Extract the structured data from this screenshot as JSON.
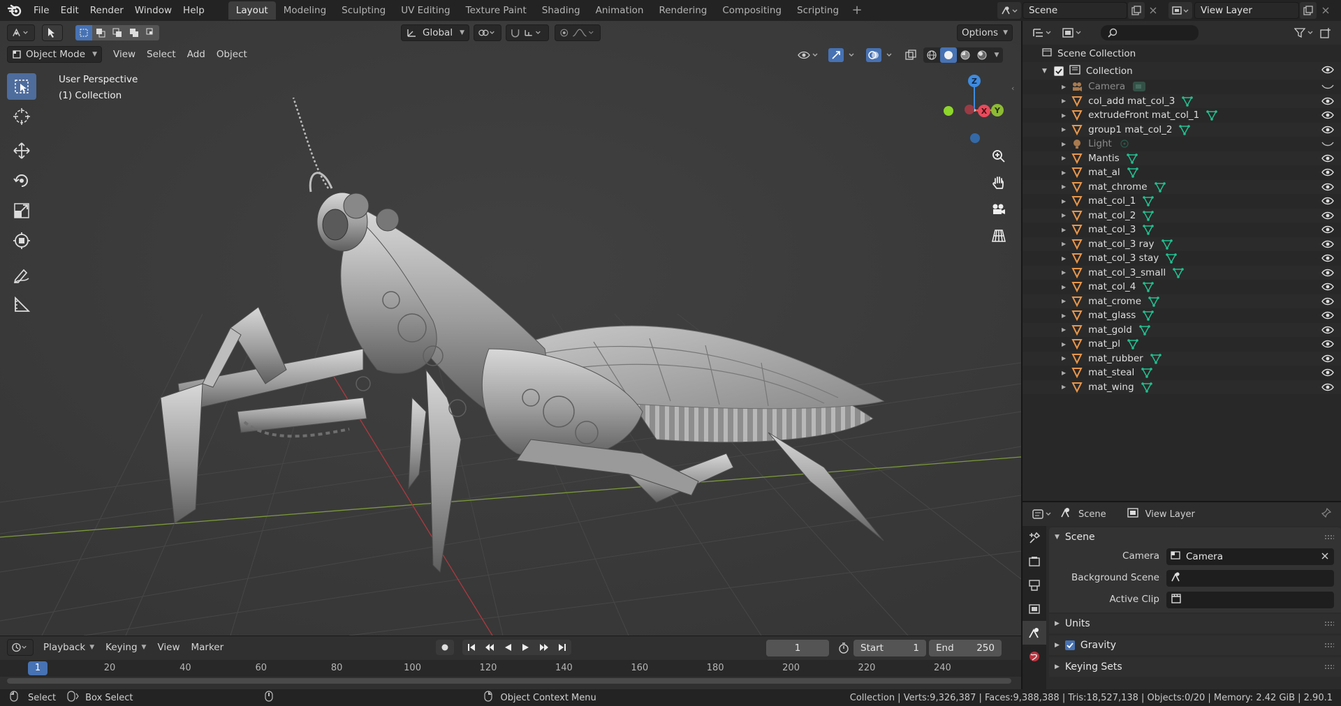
{
  "menu": [
    "File",
    "Edit",
    "Render",
    "Window",
    "Help"
  ],
  "workspaces": [
    {
      "label": "Layout",
      "active": true
    },
    {
      "label": "Modeling",
      "active": false
    },
    {
      "label": "Sculpting",
      "active": false
    },
    {
      "label": "UV Editing",
      "active": false
    },
    {
      "label": "Texture Paint",
      "active": false
    },
    {
      "label": "Shading",
      "active": false
    },
    {
      "label": "Animation",
      "active": false
    },
    {
      "label": "Rendering",
      "active": false
    },
    {
      "label": "Compositing",
      "active": false
    },
    {
      "label": "Scripting",
      "active": false
    }
  ],
  "scene_name": "Scene",
  "view_layer_name": "View Layer",
  "viewport": {
    "transform_orientation": "Global",
    "options_label": "Options",
    "mode": "Object Mode",
    "menus": [
      "View",
      "Select",
      "Add",
      "Object"
    ],
    "overlay_title": "User Perspective",
    "overlay_collection": "(1) Collection",
    "gizmo": {
      "z": "Z",
      "x": "X",
      "y": "Y"
    }
  },
  "timeline": {
    "menus": {
      "playback": "Playback",
      "keying": "Keying",
      "view": "View",
      "marker": "Marker"
    },
    "current_frame": "1",
    "start_label": "Start",
    "start": "1",
    "end_label": "End",
    "end": "250",
    "ruler_ticks": [
      "20",
      "40",
      "60",
      "80",
      "100",
      "120",
      "140",
      "160",
      "180",
      "200",
      "220",
      "240"
    ],
    "ruler_current": "1"
  },
  "statusbar": {
    "select": "Select",
    "box_select": "Box Select",
    "context_menu": "Object Context Menu",
    "stats": "Collection | Verts:9,326,387 | Faces:9,388,388 | Tris:18,527,138 | Objects:0/20 | Memory: 2.42 GiB | 2.90.1"
  },
  "outliner": {
    "root": "Scene Collection",
    "collection": "Collection",
    "items": [
      {
        "name": "Camera",
        "kind": "camera",
        "dim": true
      },
      {
        "name": "col_add mat_col_3",
        "kind": "mesh",
        "dim": false
      },
      {
        "name": "extrudeFront mat_col_1",
        "kind": "mesh",
        "dim": false
      },
      {
        "name": "group1 mat_col_2",
        "kind": "mesh",
        "dim": false
      },
      {
        "name": "Light",
        "kind": "light",
        "dim": true
      },
      {
        "name": "Mantis",
        "kind": "mesh",
        "dim": false
      },
      {
        "name": "mat_al",
        "kind": "mesh",
        "dim": false
      },
      {
        "name": "mat_chrome",
        "kind": "mesh",
        "dim": false
      },
      {
        "name": "mat_col_1",
        "kind": "mesh",
        "dim": false
      },
      {
        "name": "mat_col_2",
        "kind": "mesh",
        "dim": false
      },
      {
        "name": "mat_col_3",
        "kind": "mesh",
        "dim": false
      },
      {
        "name": "mat_col_3 ray",
        "kind": "mesh",
        "dim": false
      },
      {
        "name": "mat_col_3 stay",
        "kind": "mesh",
        "dim": false
      },
      {
        "name": "mat_col_3_small",
        "kind": "mesh",
        "dim": false
      },
      {
        "name": "mat_col_4",
        "kind": "mesh",
        "dim": false
      },
      {
        "name": "mat_crome",
        "kind": "mesh",
        "dim": false
      },
      {
        "name": "mat_glass",
        "kind": "mesh",
        "dim": false
      },
      {
        "name": "mat_gold",
        "kind": "mesh",
        "dim": false
      },
      {
        "name": "mat_pl",
        "kind": "mesh",
        "dim": false
      },
      {
        "name": "mat_rubber",
        "kind": "mesh",
        "dim": false
      },
      {
        "name": "mat_steal",
        "kind": "mesh",
        "dim": false
      },
      {
        "name": "mat_wing",
        "kind": "mesh",
        "dim": false
      }
    ]
  },
  "properties": {
    "crumb_scene": "Scene",
    "crumb_view_layer": "View Layer",
    "panel_title": "Scene",
    "camera_label": "Camera",
    "camera_value": "Camera",
    "background_scene_label": "Background Scene",
    "active_clip_label": "Active Clip",
    "units_label": "Units",
    "gravity_label": "Gravity",
    "gravity_checked": true,
    "keying_sets_label": "Keying Sets"
  },
  "colors": {
    "accent": "#4772b3",
    "mesh_icon": "#e8964a",
    "mesh_data_icon": "#21c18f",
    "axis_x": "#e94b5c",
    "axis_y": "#8dbb33",
    "axis_z": "#3f8bdf"
  }
}
